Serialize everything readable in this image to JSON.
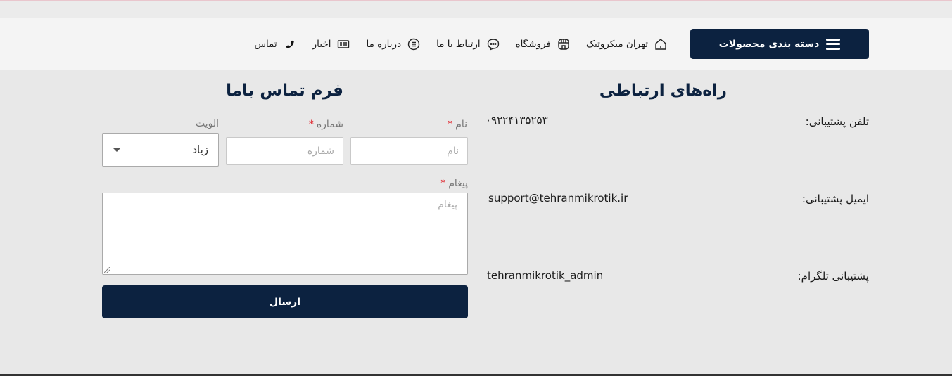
{
  "header": {
    "category_button": "دسته بندی محصولات",
    "nav": [
      {
        "label": "تهران میکروتیک",
        "icon": "home-icon"
      },
      {
        "label": "فروشگاه",
        "icon": "store-icon"
      },
      {
        "label": "ارتباط با ما",
        "icon": "chat-bubble-icon"
      },
      {
        "label": "درباره ما",
        "icon": "info-list-icon"
      },
      {
        "label": "اخبار",
        "icon": "newspaper-icon"
      },
      {
        "label": "تماس",
        "icon": "phone-icon"
      }
    ]
  },
  "contact_info": {
    "title": "راه‌های ارتباطی",
    "rows": [
      {
        "label": "تلفن پشتیبانی:",
        "value": "۰۹۲۲۴۱۳۵۲۵۳"
      },
      {
        "label": "ایمیل پشتیبانی:",
        "value": "support@tehranmikrotik.ir"
      },
      {
        "label": "پشتیبانی تلگرام:",
        "value": "tehranmikrotik_admin"
      }
    ]
  },
  "form": {
    "title": "فرم تماس باما",
    "name_label": "نام",
    "name_placeholder": "نام",
    "number_label": "شماره",
    "number_placeholder": "شماره",
    "priority_label": "الویت",
    "priority_value": "زیاد",
    "message_label": "پیغام",
    "message_placeholder": "پیغام",
    "required_mark": "*",
    "submit_label": "ارسال"
  },
  "colors": {
    "brand_navy": "#0c2240",
    "required_red": "#e01b24"
  }
}
